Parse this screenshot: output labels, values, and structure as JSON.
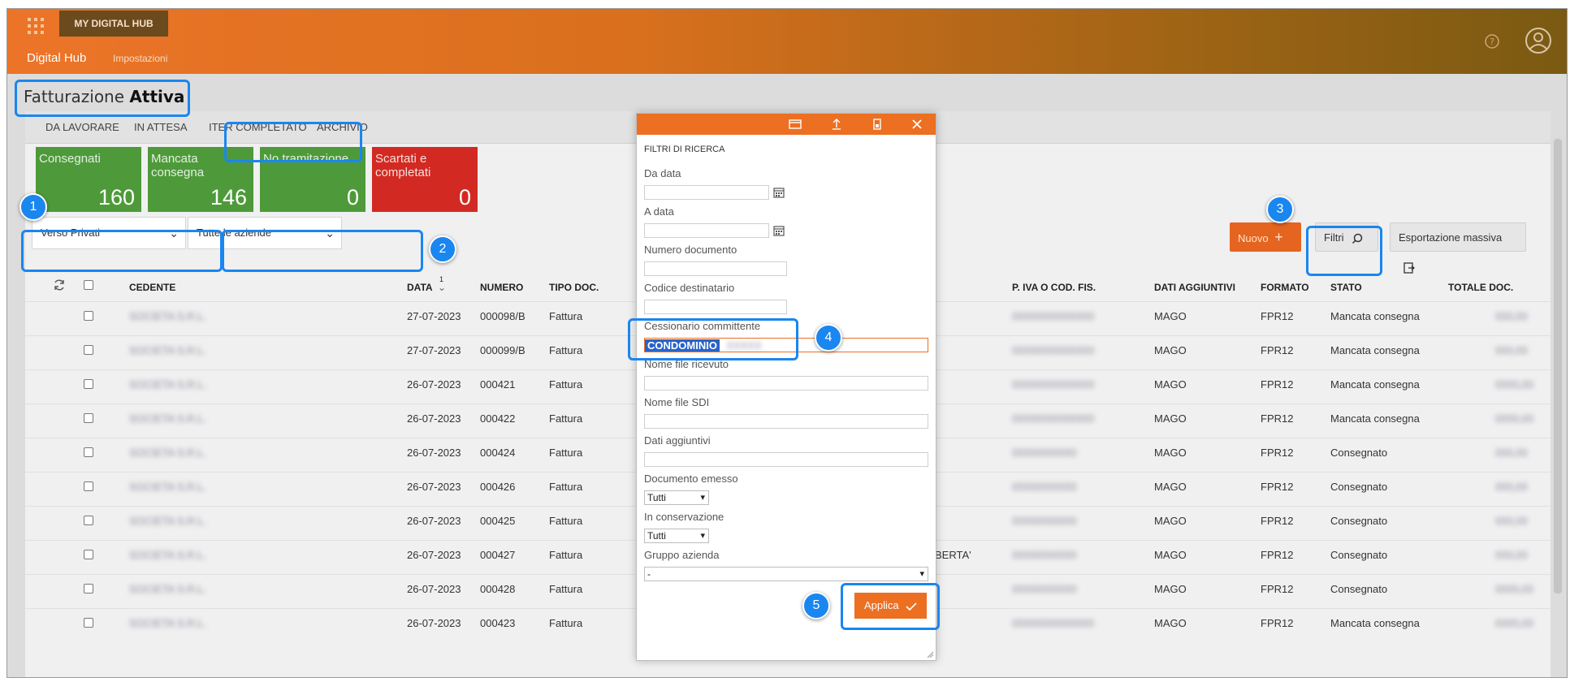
{
  "app": {
    "brand": "MY DIGITAL HUB",
    "nav_main": "Digital Hub",
    "nav_sub": "Impostazioni"
  },
  "page": {
    "title_light": "Fatturazione",
    "title_bold": "Attiva"
  },
  "tabs": [
    "DA LAVORARE",
    "IN ATTESA",
    "ITER COMPLETATO",
    "ARCHIVIO"
  ],
  "stats": [
    {
      "label": "Consegnati",
      "value": "160"
    },
    {
      "label": "Mancata consegna",
      "value": "146"
    },
    {
      "label": "No tramitazione",
      "value": "0"
    },
    {
      "label": "Scartati e completati",
      "value": "0"
    }
  ],
  "filters": {
    "verso": "Verso Privati",
    "aziende": "Tutte le aziende"
  },
  "buttons": {
    "nuovo": "Nuovo",
    "filtri": "Filtri",
    "export": "Esportazione massiva"
  },
  "table": {
    "columns": {
      "cedente": "CEDENTE",
      "data": "DATA",
      "sort": "1",
      "numero": "NUMERO",
      "tipo": "TIPO DOC.",
      "piva": "P. IVA O COD. FIS.",
      "dati": "DATI AGGIUNTIVI",
      "formato": "FORMATO",
      "stato": "STATO",
      "totale": "TOTALE DOC."
    },
    "rows": [
      {
        "cedente": "SOCIETA S.R.L.",
        "data": "27-07-2023",
        "numero": "000098/B",
        "tipo": "Fattura",
        "extra": "",
        "piva": "00000000000000",
        "dati": "MAGO",
        "formato": "FPR12",
        "stato": "Mancata consegna",
        "totale": "000,00"
      },
      {
        "cedente": "SOCIETA S.R.L.",
        "data": "27-07-2023",
        "numero": "000099/B",
        "tipo": "Fattura",
        "extra": "",
        "piva": "00000000000000",
        "dati": "MAGO",
        "formato": "FPR12",
        "stato": "Mancata consegna",
        "totale": "000,00"
      },
      {
        "cedente": "SOCIETA S.R.L.",
        "data": "26-07-2023",
        "numero": "000421",
        "tipo": "Fattura",
        "extra": "",
        "piva": "00000000000000",
        "dati": "MAGO",
        "formato": "FPR12",
        "stato": "Mancata consegna",
        "totale": "0000,00"
      },
      {
        "cedente": "SOCIETA S.R.L.",
        "data": "26-07-2023",
        "numero": "000422",
        "tipo": "Fattura",
        "extra": "",
        "piva": "00000000000000",
        "dati": "MAGO",
        "formato": "FPR12",
        "stato": "Mancata consegna",
        "totale": "0000,00"
      },
      {
        "cedente": "SOCIETA S.R.L.",
        "data": "26-07-2023",
        "numero": "000424",
        "tipo": "Fattura",
        "extra": "",
        "piva": "00000000000",
        "dati": "MAGO",
        "formato": "FPR12",
        "stato": "Consegnato",
        "totale": "000,00"
      },
      {
        "cedente": "SOCIETA S.R.L.",
        "data": "26-07-2023",
        "numero": "000426",
        "tipo": "Fattura",
        "extra": "",
        "piva": "00000000000",
        "dati": "MAGO",
        "formato": "FPR12",
        "stato": "Consegnato",
        "totale": "000,00"
      },
      {
        "cedente": "SOCIETA S.R.L.",
        "data": "26-07-2023",
        "numero": "000425",
        "tipo": "Fattura",
        "extra": "",
        "piva": "00000000000",
        "dati": "MAGO",
        "formato": "FPR12",
        "stato": "Consegnato",
        "totale": "000,00"
      },
      {
        "cedente": "SOCIETA S.R.L.",
        "data": "26-07-2023",
        "numero": "000427",
        "tipo": "Fattura",
        "extra": "BERTA'",
        "piva": "00000000000",
        "dati": "MAGO",
        "formato": "FPR12",
        "stato": "Consegnato",
        "totale": "000,00"
      },
      {
        "cedente": "SOCIETA S.R.L.",
        "data": "26-07-2023",
        "numero": "000428",
        "tipo": "Fattura",
        "extra": "",
        "piva": "00000000000",
        "dati": "MAGO",
        "formato": "FPR12",
        "stato": "Consegnato",
        "totale": "0000,00"
      },
      {
        "cedente": "SOCIETA S.R.L.",
        "data": "26-07-2023",
        "numero": "000423",
        "tipo": "Fattura",
        "extra": "",
        "piva": "00000000000000",
        "dati": "MAGO",
        "formato": "FPR12",
        "stato": "Mancata consegna",
        "totale": "0000,00"
      }
    ]
  },
  "modal": {
    "title": "FILTRI DI RICERCA",
    "fields": {
      "da_data": "Da data",
      "a_data": "A data",
      "numero_documento": "Numero documento",
      "codice_destinatario": "Codice destinatario",
      "cessionario": "Cessionario committente",
      "cessionario_value": "CONDOMINIO",
      "nome_file_ricevuto": "Nome file ricevuto",
      "nome_file_sdi": "Nome file SDI",
      "dati_aggiuntivi": "Dati aggiuntivi",
      "documento_emesso": "Documento emesso",
      "documento_emesso_value": "Tutti",
      "in_conservazione": "In conservazione",
      "in_conservazione_value": "Tutti",
      "gruppo_azienda": "Gruppo azienda",
      "gruppo_azienda_value": "-"
    },
    "apply": "Applica"
  },
  "badges": [
    "1",
    "2",
    "3",
    "4",
    "5"
  ],
  "colors": {
    "accent": "#ec6f22",
    "highlight": "#1a86f0",
    "success": "#4e9a3a",
    "danger": "#d22a22"
  }
}
